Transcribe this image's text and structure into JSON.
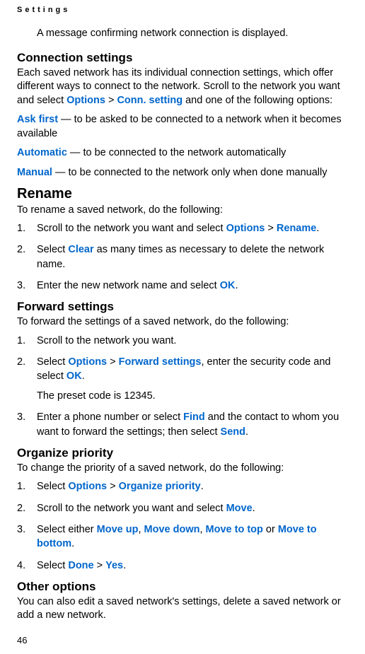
{
  "running_head": "Settings",
  "intro_message": "A message confirming network connection is displayed.",
  "connection_settings": {
    "heading": "Connection settings",
    "intro_p1": "Each saved network has its individual connection settings, which offer different ways to connect to the network. Scroll to the network you want and select ",
    "options_lbl": "Options",
    "gt": " > ",
    "conn_setting_lbl": "Conn. setting",
    "intro_p2": " and one of the following options:",
    "ask_first_lbl": "Ask first",
    "ask_first_txt": " — to be asked to be connected to a network when it becomes available",
    "automatic_lbl": "Automatic",
    "automatic_txt": " — to be connected to the network automatically",
    "manual_lbl": "Manual",
    "manual_txt": " — to be connected to the network only when done manually"
  },
  "rename": {
    "heading": "Rename",
    "intro": "To rename a saved network, do the following:",
    "s1a": "Scroll to the network you want and select ",
    "options_lbl": "Options",
    "gt": " > ",
    "rename_lbl": "Rename",
    "period": ".",
    "s2a": "Select ",
    "clear_lbl": "Clear",
    "s2b": " as many times as necessary to delete the network name.",
    "s3a": "Enter the new network name and select ",
    "ok_lbl": "OK"
  },
  "forward": {
    "heading": "Forward settings",
    "intro": "To forward the settings of a saved network, do the following:",
    "s1": "Scroll to the network you want.",
    "s2a": "Select ",
    "options_lbl": "Options",
    "gt": " > ",
    "fwd_lbl": "Forward settings",
    "s2b": ", enter the security code and select ",
    "ok_lbl": "OK",
    "period": ".",
    "s2_sub": "The preset code is 12345.",
    "s3a": "Enter a phone number or select ",
    "find_lbl": "Find",
    "s3b": " and the contact to whom you want to forward the settings; then select ",
    "send_lbl": "Send"
  },
  "organize": {
    "heading": "Organize priority",
    "intro": "To change the priority of a saved network, do the following:",
    "s1a": "Select ",
    "options_lbl": "Options",
    "gt": " > ",
    "org_lbl": "Organize priority",
    "period": ".",
    "s2a": "Scroll to the network you want and select ",
    "move_lbl": "Move",
    "s3a": "Select either ",
    "move_up_lbl": "Move up",
    "comma_sp": ", ",
    "move_down_lbl": "Move down",
    "move_top_lbl": "Move to top",
    "or_sp": " or ",
    "move_bottom_lbl": "Move to bottom",
    "s4a": "Select ",
    "done_lbl": "Done",
    "yes_lbl": "Yes"
  },
  "other": {
    "heading": "Other options",
    "text": "You can also edit a saved network's settings, delete a saved network or add a new network."
  },
  "page_number": "46"
}
